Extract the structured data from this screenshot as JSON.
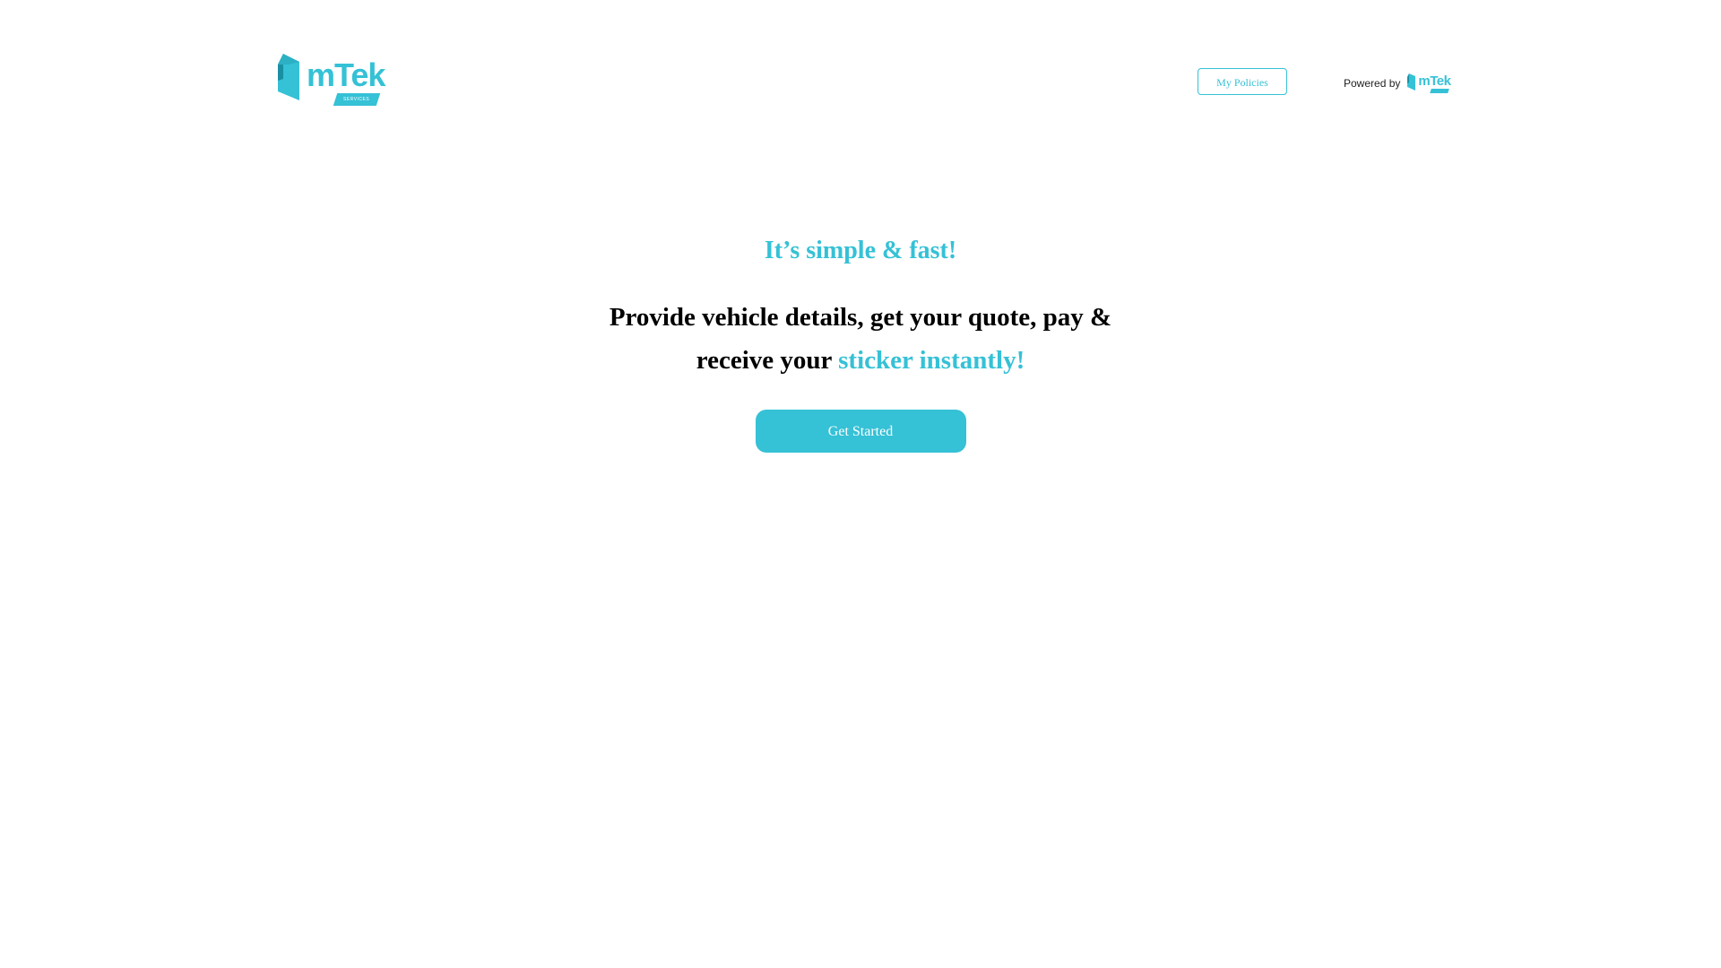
{
  "header": {
    "brand": {
      "icon": "mtek-cube-icon",
      "name": "mTek",
      "tagline": "SERVICES"
    },
    "my_policies_label": "My Policies",
    "powered_by": {
      "label": "Powered by",
      "logo_name": "mTek"
    }
  },
  "hero": {
    "tagline": "It’s simple & fast!",
    "headline_part1": "Provide vehicle details, get your quote, pay & receive your",
    "headline_accent": "sticker instantly!",
    "cta_label": "Get Started"
  },
  "colors": {
    "accent": "#35c1d6",
    "accent_dark": "#1a8fa3",
    "text": "#000000",
    "background": "#ffffff"
  }
}
